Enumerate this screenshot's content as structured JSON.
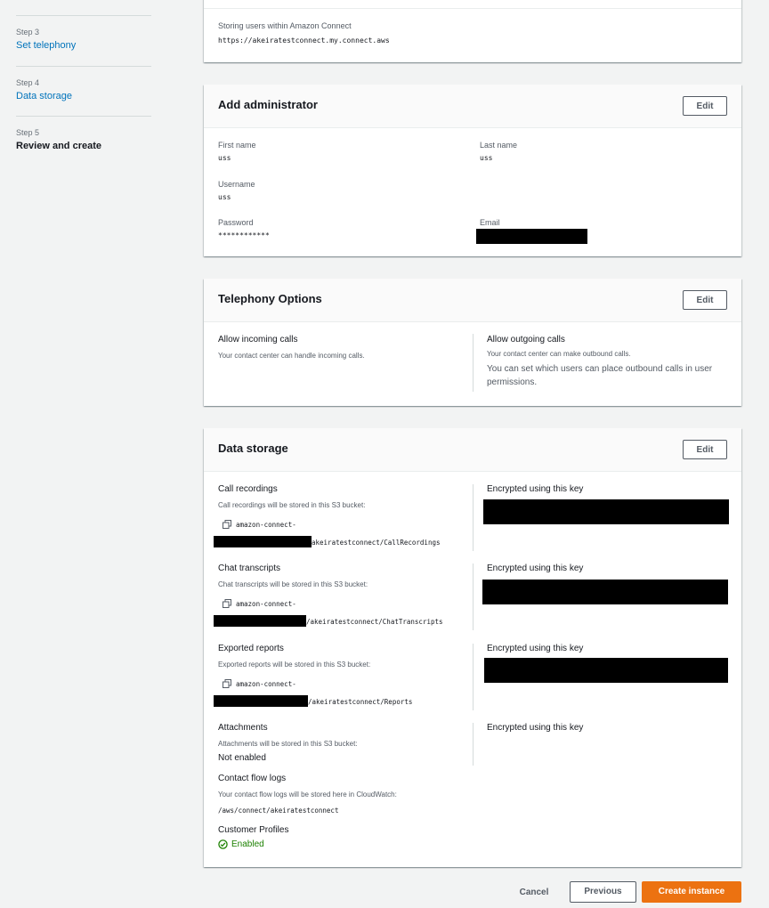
{
  "sidebar": {
    "steps": [
      {
        "num": "Step 3",
        "label": "Set telephony"
      },
      {
        "num": "Step 4",
        "label": "Data storage"
      },
      {
        "num": "Step 5",
        "label": "Review and create"
      }
    ]
  },
  "identity": {
    "label": "Storing users within Amazon Connect",
    "url": "https://akeiratestconnect.my.connect.aws"
  },
  "admin": {
    "title": "Add administrator",
    "edit": "Edit",
    "first_name_label": "First name",
    "first_name": "uss",
    "last_name_label": "Last name",
    "last_name": "uss",
    "username_label": "Username",
    "username": "uss",
    "password_label": "Password",
    "password": "************",
    "email_label": "Email"
  },
  "telephony": {
    "title": "Telephony Options",
    "edit": "Edit",
    "incoming_title": "Allow incoming calls",
    "incoming_desc": "Your contact center can handle incoming calls.",
    "outgoing_title": "Allow outgoing calls",
    "outgoing_desc": "Your contact center can make outbound calls.",
    "outgoing_note": "You can set which users can place outbound calls in user permissions."
  },
  "storage": {
    "title": "Data storage",
    "edit": "Edit",
    "encrypted_label": "Encrypted using this key",
    "call": {
      "title": "Call recordings",
      "desc": "Call recordings will be stored in this S3 bucket:",
      "bucket_prefix": "amazon-connect-",
      "bucket_suffix": "akeiratestconnect/CallRecordings"
    },
    "chat": {
      "title": "Chat transcripts",
      "desc": "Chat transcripts will be stored in this S3 bucket:",
      "bucket_prefix": "amazon-connect-",
      "bucket_suffix": "/akeiratestconnect/ChatTranscripts"
    },
    "reports": {
      "title": "Exported reports",
      "desc": "Exported reports will be stored in this S3 bucket:",
      "bucket_prefix": "amazon-connect-",
      "bucket_suffix": "/akeiratestconnect/Reports"
    },
    "attachments": {
      "title": "Attachments",
      "desc": "Attachments will be stored in this S3 bucket:",
      "value": "Not enabled"
    },
    "flow_logs": {
      "title": "Contact flow logs",
      "desc": "Your contact flow logs will be stored here in CloudWatch:",
      "value": "/aws/connect/akeiratestconnect"
    },
    "profiles": {
      "title": "Customer Profiles",
      "value": "Enabled"
    }
  },
  "footer": {
    "cancel": "Cancel",
    "previous": "Previous",
    "create": "Create instance"
  },
  "colors": {
    "link": "#0073bb",
    "primary_button": "#ec7211",
    "success": "#1d8102"
  }
}
